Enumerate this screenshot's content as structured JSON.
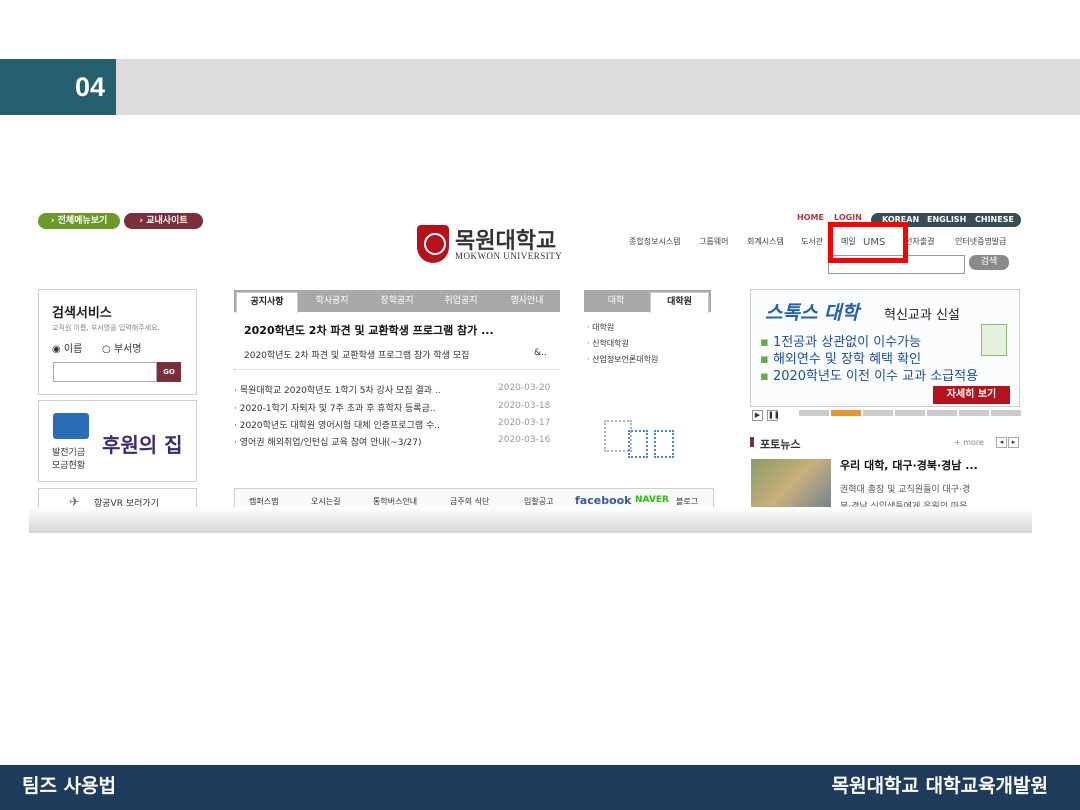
{
  "slide": {
    "number": "04",
    "footer_left": "팀즈 사용법",
    "footer_right": "목원대학교 대학교육개발원"
  },
  "site": {
    "top_buttons": {
      "all_menu": "› 전체메뉴보기",
      "campus_site": "› 교내사이트"
    },
    "logo": {
      "ko": "목원대학교",
      "en": "MOKWON UNIVERSITY"
    },
    "top_links": {
      "home": "HOME",
      "login": "LOGIN"
    },
    "languages": [
      "KOREAN",
      "ENGLISH",
      "CHINESE"
    ],
    "system_nav": [
      "종합정보시스템",
      "그룹웨어",
      "회계시스템",
      "도서관",
      "메일",
      "UMS",
      "전자출결",
      "인터넷증명발급"
    ],
    "search_button": "검색",
    "search_service": {
      "title": "검색서비스",
      "description": "교직원 이름, 부서명을 입력해주세요.",
      "options": [
        "이름",
        "부서명"
      ],
      "go": "GO"
    },
    "fund": {
      "label_line1": "발전기금",
      "label_line2": "모금현황",
      "sign_text": "후원의 집"
    },
    "vr_button": "항공VR 보러가기",
    "notice": {
      "tabs": [
        "공지사항",
        "학사공지",
        "장학공지",
        "취업공지",
        "행사안내"
      ],
      "headline": "2020학년도 2차 파견 및 교환학생 프로그램 참가 ...",
      "summary": "2020학년도 2차 파견 및 교환학생 프로그램 참가 학생 모집",
      "summary_more": "&..",
      "items": [
        {
          "title": "목원대학교 2020학년도 1학기 5차 강사 모집 결과 ..",
          "date": "2020-03-20"
        },
        {
          "title": "2020-1학기 자퇴자 및 7주 초과 후 휴학자 등록금..",
          "date": "2020-03-18"
        },
        {
          "title": "2020학년도 대학원 영어시험 대체 인증프로그램 수..",
          "date": "2020-03-17"
        },
        {
          "title": "영어권 해외취업/인턴십 교육 참여 안내(~3/27)",
          "date": "2020-03-16"
        }
      ]
    },
    "graduate": {
      "tabs": [
        "대학",
        "대학원"
      ],
      "items": [
        "대학원",
        "신학대학원",
        "산업정보언론대학원"
      ]
    },
    "banner": {
      "title_brand": "스톡스 대학",
      "title_rest": "혁신교과 신설",
      "bullets": [
        "1전공과 상관없이 이수가능",
        "해외연수 및 장학 혜택 확인",
        "2020학년도 이전 이수 교과 소급적용"
      ],
      "more": "자세히 보기"
    },
    "photo_news": {
      "title": "포토뉴스",
      "more": "+ more",
      "headline": "우리 대학, 대구·경북·경남 ...",
      "body_line1": "권혁대 총장 및 교직원들이 대구·경",
      "body_line2": "북·경남 신입생들에게 응원의 마음"
    },
    "quick_links": [
      "캠퍼스맵",
      "오시는길",
      "통학버스안내",
      "금주의 식단",
      "입찰공고",
      "facebook",
      "NAVER",
      "블로그"
    ]
  },
  "colors": {
    "slide_accent": "#25606e",
    "footer_bg": "#1e3b5c",
    "highlight_box": "#ff0000",
    "brand_red": "#b5121b",
    "banner_blue": "#1f5fb4"
  }
}
